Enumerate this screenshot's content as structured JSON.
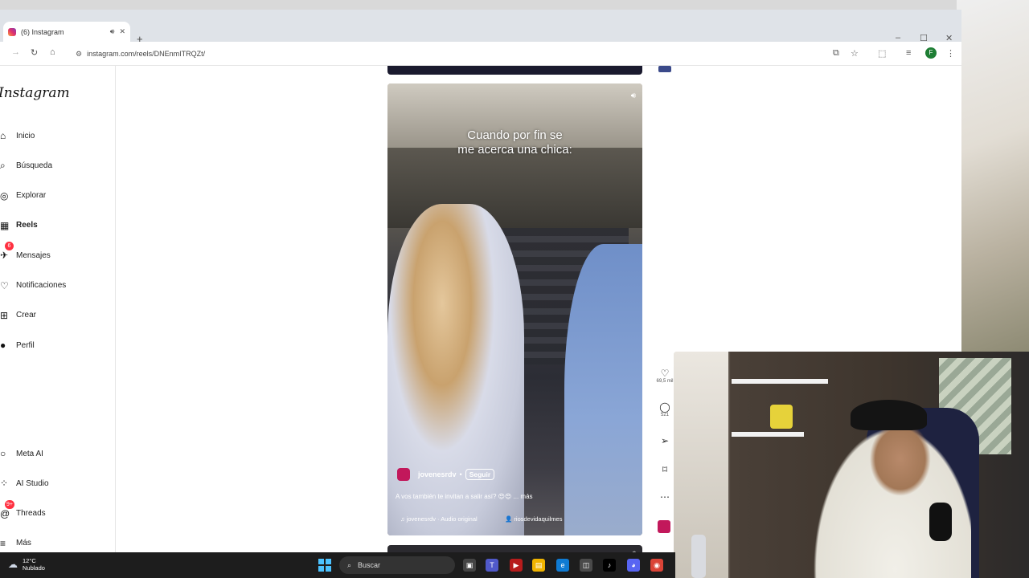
{
  "browser": {
    "tab_title": "(6) Instagram",
    "new_tab": "+",
    "url": "instagram.com/reels/DNEnmITRQZt/",
    "window_controls": {
      "minimize": "–",
      "maximize": "☐",
      "close": "✕"
    }
  },
  "instagram": {
    "logo": "Instagram",
    "nav": [
      {
        "label": "Inicio",
        "icon": "home-icon",
        "glyph": "⌂"
      },
      {
        "label": "Búsqueda",
        "icon": "search-icon",
        "glyph": "⌕"
      },
      {
        "label": "Explorar",
        "icon": "compass-icon",
        "glyph": "◎"
      },
      {
        "label": "Reels",
        "icon": "reels-icon",
        "glyph": "▦"
      },
      {
        "label": "Mensajes",
        "icon": "messenger-icon",
        "glyph": "✈",
        "badge": "6"
      },
      {
        "label": "Notificaciones",
        "icon": "heart-icon",
        "glyph": "♡"
      },
      {
        "label": "Crear",
        "icon": "plus-square-icon",
        "glyph": "⊞"
      },
      {
        "label": "Perfil",
        "icon": "avatar-icon",
        "glyph": "●"
      }
    ],
    "nav_bottom": [
      {
        "label": "Meta AI",
        "icon": "meta-ai-icon",
        "glyph": "○"
      },
      {
        "label": "AI Studio",
        "icon": "ai-studio-icon",
        "glyph": "⁘"
      },
      {
        "label": "Threads",
        "icon": "threads-icon",
        "glyph": "@",
        "badge": "9+"
      },
      {
        "label": "Más",
        "icon": "menu-icon",
        "glyph": "≡"
      }
    ],
    "reel": {
      "overlay_text_line1": "Cuando por fin se",
      "overlay_text_line2": "me acerca una chica:",
      "username": "jovenesrdv",
      "separator": "•",
      "follow_label": "Seguir",
      "caption": "A vos también te invitan a salir así? 😍😍 ... más",
      "audio": "♫ jovenesrdv · Audio original",
      "collab": "👤 riosdevidaquilmes"
    },
    "actions": {
      "likes": "69,5 mil",
      "comments": "521"
    }
  },
  "taskbar": {
    "temperature": "12°C",
    "weather": "Nublado",
    "search_placeholder": "Buscar"
  }
}
